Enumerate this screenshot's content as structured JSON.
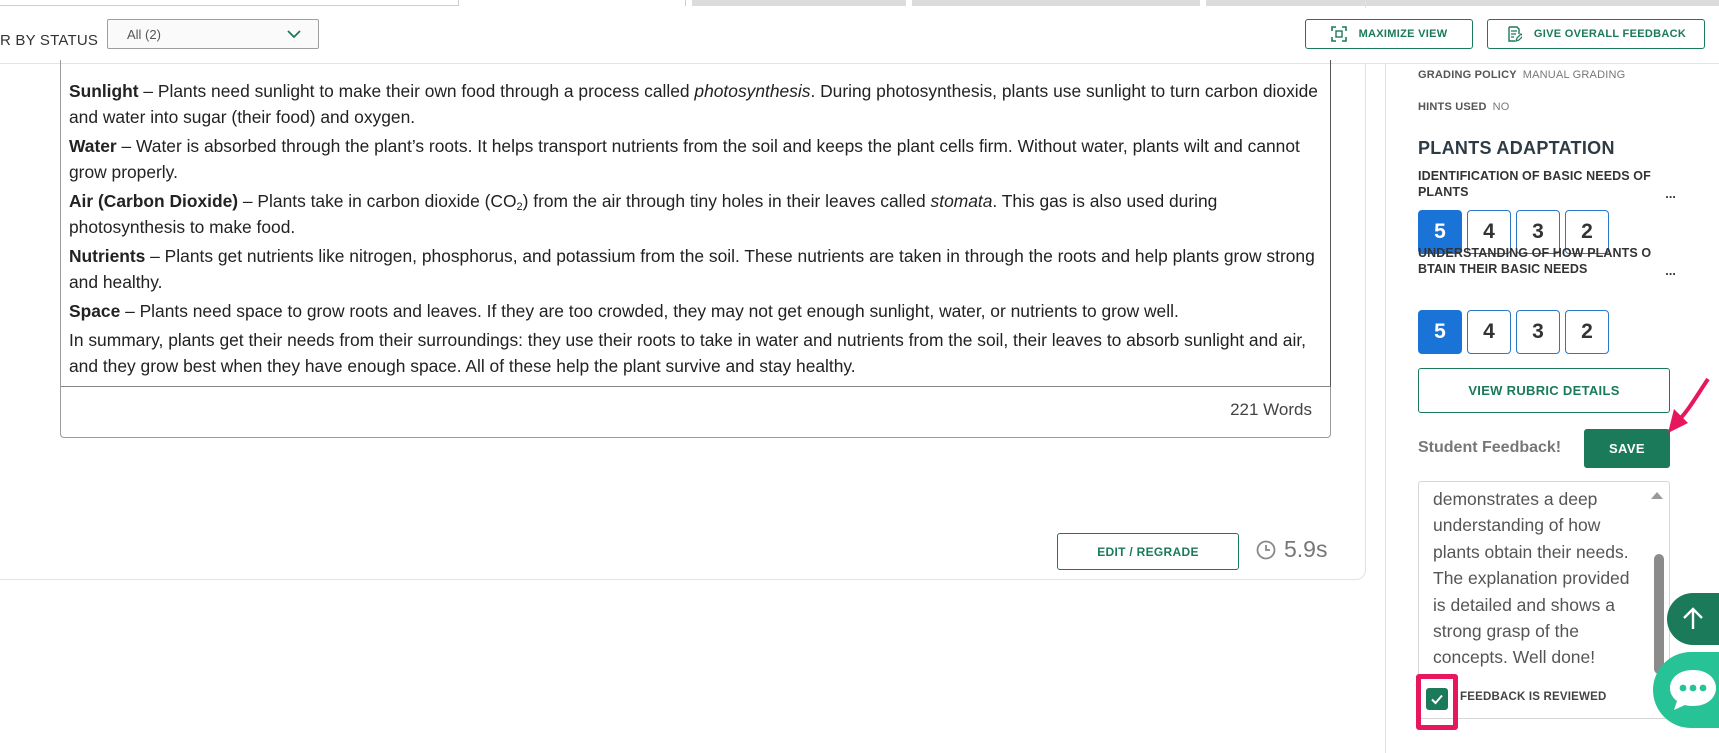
{
  "filter": {
    "label": "R BY STATUS",
    "selected": "All (2)"
  },
  "header": {
    "maximize_label": "MAXIMIZE VIEW",
    "give_feedback_label": "GIVE OVERALL FEEDBACK"
  },
  "essay": {
    "paragraphs": {
      "sunlight_term": "Sunlight",
      "sunlight_a": " – Plants need sunlight to make their own food through a process called ",
      "sunlight_italic": "photosynthesis",
      "sunlight_b": ". During photosynthesis, plants use sunlight to turn carbon dioxide and water into sugar (their food) and oxygen.",
      "water_term": "Water",
      "water_text": " – Water is absorbed through the plant’s roots. It helps transport nutrients from the soil and keeps the plant cells firm. Without water, plants wilt and cannot grow properly.",
      "air_term": "Air (Carbon Dioxide)",
      "air_a": " – Plants take in carbon dioxide (CO",
      "air_sub": "2",
      "air_b": ") from the air through tiny holes in their leaves called ",
      "air_italic": "stomata",
      "air_c": ". This gas is also used during photosynthesis to make food.",
      "nutrients_term": "Nutrients",
      "nutrients_text": " – Plants get nutrients like nitrogen, phosphorus, and potassium from the soil. These nutrients are taken in through the roots and help plants grow strong and healthy.",
      "space_term": "Space",
      "space_text": " – Plants need space to grow roots and leaves. If they are too crowded, they may not get enough sunlight, water, or nutrients to grow well.",
      "summary": "In summary, plants get their needs from their surroundings: they use their roots to take in water and nutrients from the soil, their leaves to absorb sunlight and air, and they grow best when they have enough space. All of these help the plant survive and stay healthy."
    },
    "word_count": "221 Words"
  },
  "actions": {
    "edit_regrade_label": "EDIT / REGRADE",
    "timer_value": "5.9s"
  },
  "sidebar": {
    "grading_policy_label": "GRADING POLICY",
    "grading_policy_value": "MANUAL GRADING",
    "hints_used_label": "HINTS USED",
    "hints_used_value": "NO",
    "rubric_title": "PLANTS ADAPTATION",
    "criteria": [
      {
        "title": "IDENTIFICATION OF BASIC NEEDS OF PLANTS",
        "more": "...",
        "scores": [
          "5",
          "4",
          "3",
          "2"
        ],
        "selected": "5"
      },
      {
        "title": "UNDERSTANDING OF HOW PLANTS O BTAIN THEIR BASIC NEEDS",
        "more": "...",
        "scores": [
          "5",
          "4",
          "3",
          "2"
        ],
        "selected": "5"
      }
    ],
    "view_rubric_label": "VIEW RUBRIC DETAILS",
    "feedback_label": "Student Feedback!",
    "save_label": "SAVE",
    "feedback_text": "demonstrates a deep understanding of how plants obtain their needs. The explanation provided is detailed and shows a strong grasp of the concepts. Well done!",
    "reviewed_label": "FEEDBACK IS REVIEWED",
    "reviewed_checked": true
  },
  "colors": {
    "brand_green": "#1a7a5a",
    "selected_blue": "#1a73d6",
    "highlight_pink": "#e8175d",
    "chat_green": "#27c296"
  },
  "icons": {
    "maximize": "maximize-icon",
    "feedback": "feedback-edit-icon",
    "chevron": "chevron-down-icon",
    "clock": "clock-icon",
    "check": "check-icon",
    "arrow_up": "arrow-up-icon",
    "chat": "chat-bubble-icon"
  }
}
